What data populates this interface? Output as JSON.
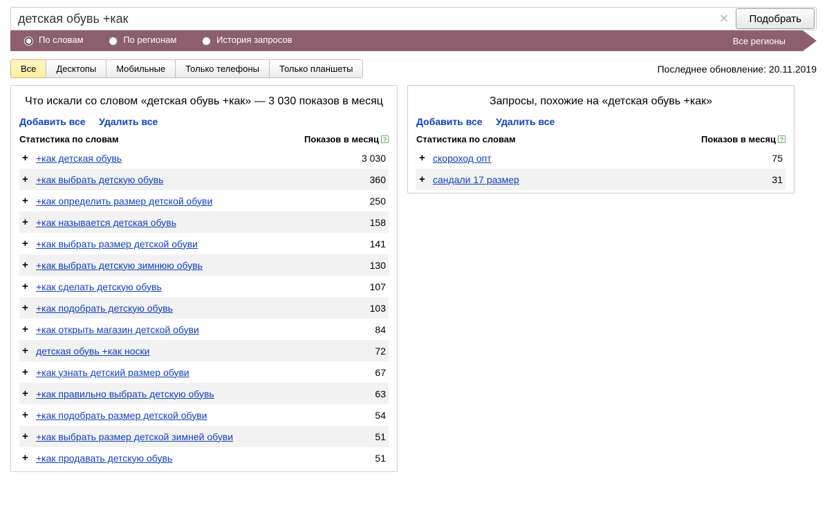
{
  "search": {
    "value": "детская обувь +как",
    "submit": "Подобрать"
  },
  "filters": {
    "by_words": "По словам",
    "by_regions": "По регионам",
    "history": "История запросов",
    "all_regions": "Все регионы"
  },
  "device_tabs": [
    "Все",
    "Десктопы",
    "Мобильные",
    "Только телефоны",
    "Только планшеты"
  ],
  "last_update": "Последнее обновление: 20.11.2019",
  "left_panel": {
    "title": "Что искали со словом «детская обувь +как» — 3 030 показов в месяц",
    "add_all": "Добавить все",
    "delete_all": "Удалить все",
    "col_words": "Статистика по словам",
    "col_count": "Показов в месяц",
    "rows": [
      {
        "kw": "+как детская обувь",
        "count": "3 030"
      },
      {
        "kw": "+как выбрать детскую обувь",
        "count": "360"
      },
      {
        "kw": "+как определить размер детской обуви",
        "count": "250"
      },
      {
        "kw": "+как называется детская обувь",
        "count": "158"
      },
      {
        "kw": "+как выбрать размер детской обуви",
        "count": "141"
      },
      {
        "kw": "+как выбрать детскую зимнюю обувь",
        "count": "130"
      },
      {
        "kw": "+как сделать детскую обувь",
        "count": "107"
      },
      {
        "kw": "+как подобрать детскую обувь",
        "count": "103"
      },
      {
        "kw": "+как открыть магазин детской обуви",
        "count": "84"
      },
      {
        "kw": "детская обувь +как носки",
        "count": "72"
      },
      {
        "kw": "+как узнать детский размер обуви",
        "count": "67"
      },
      {
        "kw": "+как правильно выбрать детскую обувь",
        "count": "63"
      },
      {
        "kw": "+как подобрать размер детской обуви",
        "count": "54"
      },
      {
        "kw": "+как выбрать размер детской зимней обуви",
        "count": "51"
      },
      {
        "kw": "+как продавать детскую обувь",
        "count": "51"
      }
    ]
  },
  "right_panel": {
    "title": "Запросы, похожие на «детская обувь +как»",
    "add_all": "Добавить все",
    "delete_all": "Удалить все",
    "col_words": "Статистика по словам",
    "col_count": "Показов в месяц",
    "rows": [
      {
        "kw": "скороход опт",
        "count": "75"
      },
      {
        "kw": "сандали 17 размер",
        "count": "31"
      }
    ]
  }
}
